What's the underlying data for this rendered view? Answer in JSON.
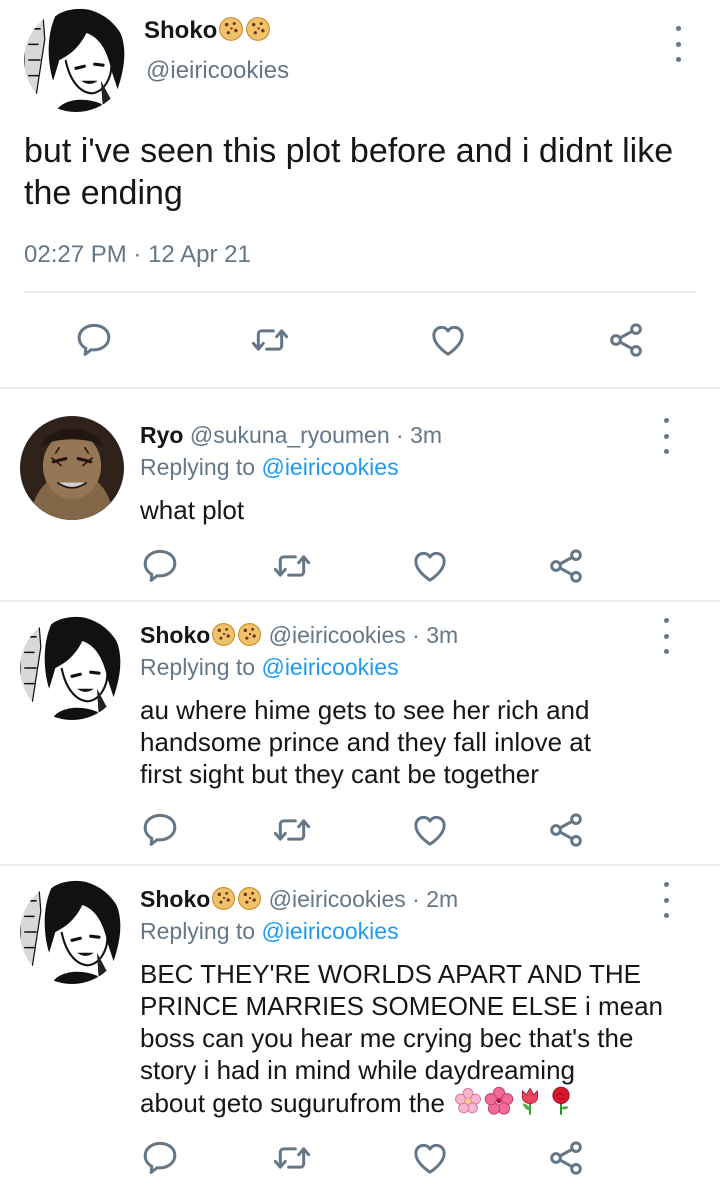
{
  "main_tweet": {
    "display_name": "Shoko",
    "handle": "@ieiricookies",
    "text": "but i've seen this plot before and i didnt like the ending",
    "time": "02:27 PM",
    "date": "12 Apr 21"
  },
  "replies": [
    {
      "display_name": "Ryo",
      "handle": "@sukuna_ryoumen",
      "age": "3m",
      "replying_prefix": "Replying to",
      "replying_to": "@ieiricookies",
      "text": "what plot"
    },
    {
      "display_name": "Shoko",
      "handle": "@ieiricookies",
      "age": "3m",
      "replying_prefix": "Replying to",
      "replying_to": "@ieiricookies",
      "text_lines": [
        "au where hime gets to see her rich and",
        "handsome prince and they fall inlove at",
        "first sight but they cant be together"
      ]
    },
    {
      "display_name": "Shoko",
      "handle": "@ieiricookies",
      "age": "2m",
      "replying_prefix": "Replying to",
      "replying_to": "@ieiricookies",
      "text_lines": [
        "BEC THEY'RE WORLDS APART AND THE",
        "PRINCE MARRIES SOMEONE ELSE i mean",
        "boss can you hear me crying bec that's the",
        "story i had in mind while daydreaming",
        "about geto sugurufrom the"
      ],
      "emojis": [
        "cherry-blossom",
        "hibiscus",
        "tulip",
        "rose"
      ]
    }
  ],
  "colors": {
    "link": "#1d9bf0",
    "muted": "#657786",
    "divider": "#e6ecf0",
    "icon": "#657786"
  },
  "icons": [
    "cookie-emoji",
    "more-icon",
    "reply-icon",
    "retweet-icon",
    "like-icon",
    "share-icon"
  ]
}
